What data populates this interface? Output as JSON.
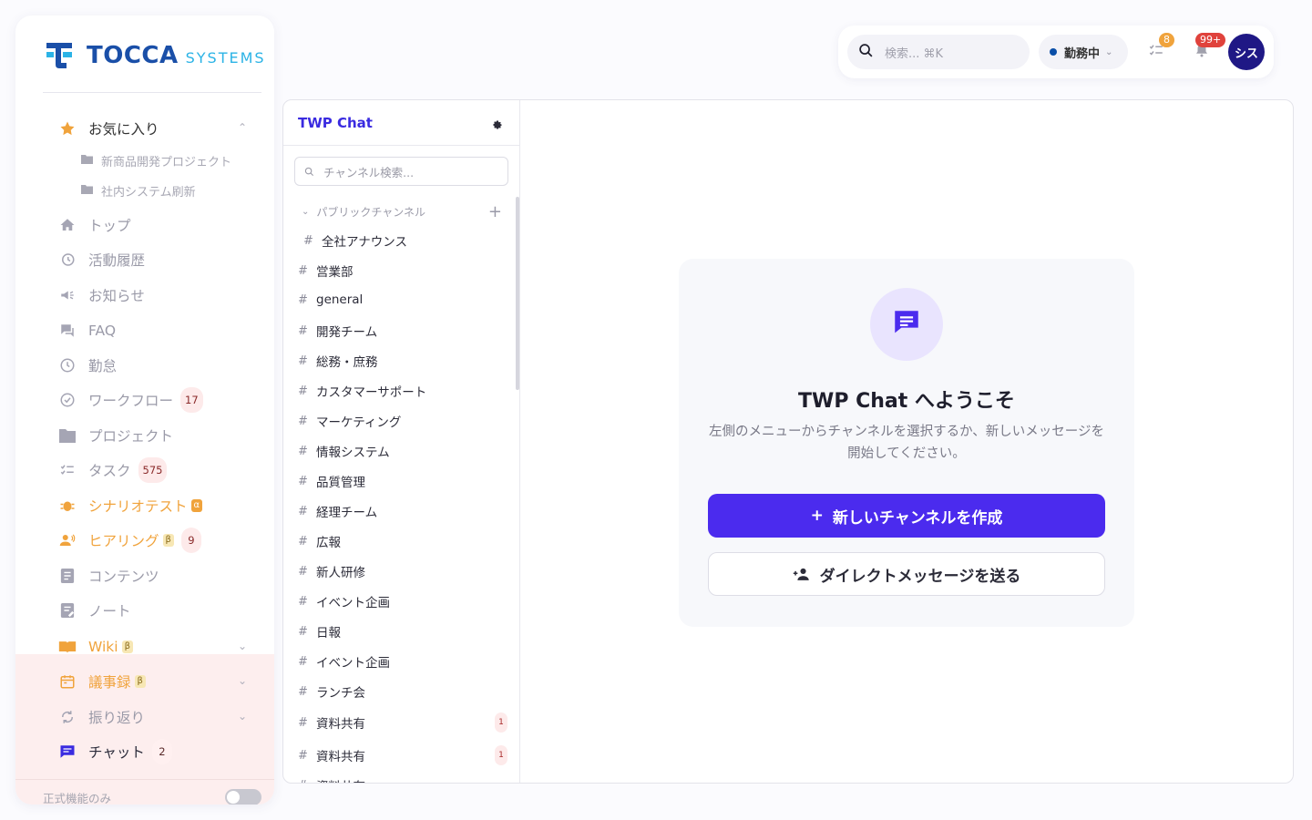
{
  "brand": {
    "name": "TOCCA",
    "sub": "SYSTEMS"
  },
  "sidebar": {
    "favorites": {
      "label": "お気に入り",
      "items": [
        "新商品開発プロジェクト",
        "社内システム刷新"
      ]
    },
    "items": [
      {
        "label": "トップ",
        "icon": "home-icon"
      },
      {
        "label": "活動履歴",
        "icon": "history-icon"
      },
      {
        "label": "お知らせ",
        "icon": "megaphone-icon"
      },
      {
        "label": "FAQ",
        "icon": "faq-icon"
      },
      {
        "label": "勤怠",
        "icon": "clock-icon"
      },
      {
        "label": "ワークフロー",
        "icon": "check-circle-icon",
        "badge": "17"
      },
      {
        "label": "プロジェクト",
        "icon": "folder-icon"
      },
      {
        "label": "タスク",
        "icon": "tasks-icon",
        "badge": "575"
      },
      {
        "label": "シナリオテスト",
        "icon": "bug-icon",
        "tag": "α"
      },
      {
        "label": "ヒアリング",
        "icon": "people-icon",
        "tag": "β",
        "badge": "9"
      },
      {
        "label": "コンテンツ",
        "icon": "document-icon"
      },
      {
        "label": "ノート",
        "icon": "note-icon"
      },
      {
        "label": "Wiki",
        "icon": "book-icon",
        "tag": "β"
      },
      {
        "label": "議事録",
        "icon": "calendar-icon",
        "tag": "β"
      },
      {
        "label": "振り返り",
        "icon": "refresh-icon"
      },
      {
        "label": "チャット",
        "icon": "chat-icon",
        "badge": "2"
      }
    ],
    "footer_label": "正式機能のみ"
  },
  "topbar": {
    "search_placeholder": "検索... ⌘K",
    "status": "勤務中",
    "tasks_badge": "8",
    "notif_badge": "99+",
    "avatar": "シス"
  },
  "chat": {
    "title": "TWP Chat",
    "search_placeholder": "チャンネル検索...",
    "section": "パブリックチャンネル",
    "channels": [
      {
        "name": "全社アナウンス"
      },
      {
        "name": "営業部"
      },
      {
        "name": "general"
      },
      {
        "name": "開発チーム"
      },
      {
        "name": "総務・庶務"
      },
      {
        "name": "カスタマーサポート"
      },
      {
        "name": "マーケティング"
      },
      {
        "name": "情報システム"
      },
      {
        "name": "品質管理"
      },
      {
        "name": "経理チーム"
      },
      {
        "name": "広報"
      },
      {
        "name": "新人研修"
      },
      {
        "name": "イベント企画"
      },
      {
        "name": "日報"
      },
      {
        "name": "イベント企画"
      },
      {
        "name": "ランチ会"
      },
      {
        "name": "資料共有",
        "count": "1"
      },
      {
        "name": "資料共有",
        "count": "1"
      },
      {
        "name": "資料共有"
      }
    ]
  },
  "welcome": {
    "title": "TWP Chat へようこそ",
    "description": "左側のメニューからチャンネルを選択するか、新しいメッセージを開始してください。",
    "create_button": "新しいチャンネルを作成",
    "dm_button": "ダイレクトメッセージを送る"
  },
  "colors": {
    "accent": "#4b2bee",
    "brand": "#1a4fa8",
    "orange": "#f0a33c"
  }
}
